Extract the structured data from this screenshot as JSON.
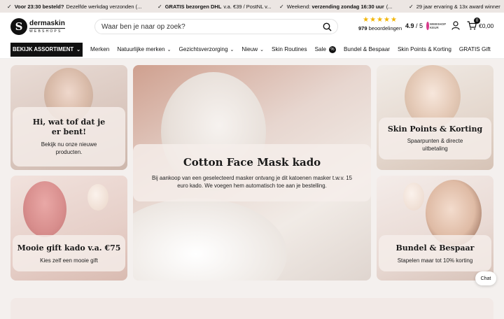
{
  "topbar": [
    {
      "bold": "Voor 23:30 besteld?",
      "text": "Dezelfde werkdag verzonden (..."
    },
    {
      "bold": "GRATIS bezorgen DHL",
      "text": "v.a. €39 / PostNL v..."
    },
    {
      "bold": "",
      "text": "Weekend: ",
      "bold2": "verzending zondag 16:30 uur",
      "text2": " (..."
    },
    {
      "bold": "",
      "text": "29 jaar ervaring & 13x award winner"
    }
  ],
  "logo": {
    "mark": "S",
    "name": "dermaskin",
    "sub": "WEBSHOPS"
  },
  "search": {
    "placeholder": "Waar ben je naar op zoek?"
  },
  "rating": {
    "stars": "★★★★★",
    "count": "979",
    "count_label": "beoordelingen",
    "score": "4.9",
    "score_suffix": "/ 5"
  },
  "keur": {
    "label": "WEBSHOP KEUR"
  },
  "cart": {
    "count": "0",
    "total": "€0,00"
  },
  "nav": {
    "assortment": "BEKIJK ASSORTIMENT",
    "items": [
      {
        "label": "Merken",
        "chev": false
      },
      {
        "label": "Natuurlijke merken",
        "chev": true
      },
      {
        "label": "Gezichtsverzorging",
        "chev": true
      },
      {
        "label": "Nieuw",
        "chev": true
      },
      {
        "label": "Skin Routines",
        "chev": false
      },
      {
        "label": "Sale",
        "chev": false,
        "badge": "%"
      },
      {
        "label": "Bundel & Bespaar",
        "chev": false
      },
      {
        "label": "Skin Points & Korting",
        "chev": false
      },
      {
        "label": "GRATIS Gift",
        "chev": false
      }
    ]
  },
  "cards": {
    "welcome": {
      "title": "Hi, wat tof dat je er bent!",
      "subtitle": "Bekijk nu onze nieuwe producten."
    },
    "mask": {
      "title": "Cotton Face Mask kado",
      "subtitle": "Bij aankoop van een geselecteerd masker ontvang je dit katoenen masker t.w.v. 15 euro kado. We voegen hem automatisch toe aan je bestelling."
    },
    "points": {
      "title": "Skin Points & Korting",
      "subtitle": "Spaarpunten & directe uitbetaling"
    },
    "gift": {
      "title": "Mooie gift kado v.a. €75",
      "subtitle": "Kies zelf een mooie gift"
    },
    "bundle": {
      "title": "Bundel & Bespaar",
      "subtitle": "Stapelen maar tot 10% korting"
    }
  },
  "chat": {
    "label": "Chat"
  },
  "colors": {
    "accent": "#111111",
    "stars": "#f2b400",
    "topbar": "#ece6e3",
    "keur": "#d63a8a"
  }
}
